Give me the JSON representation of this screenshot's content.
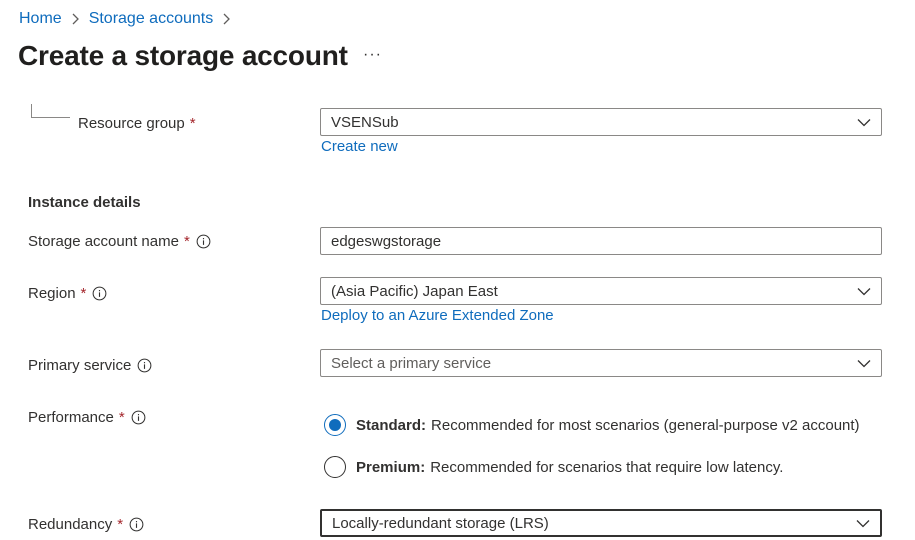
{
  "breadcrumb": {
    "items": [
      "Home",
      "Storage accounts"
    ]
  },
  "page": {
    "title": "Create a storage account",
    "more": "···"
  },
  "resource_group": {
    "label": "Resource group",
    "required": "*",
    "value": "VSENSub",
    "create_new": "Create new"
  },
  "instance_details": {
    "title": "Instance details"
  },
  "storage_account_name": {
    "label": "Storage account name",
    "required": "*",
    "value": "edgeswgstorage"
  },
  "region": {
    "label": "Region",
    "required": "*",
    "value": "(Asia Pacific) Japan East",
    "extended_zone_link": "Deploy to an Azure Extended Zone"
  },
  "primary_service": {
    "label": "Primary service",
    "placeholder": "Select a primary service"
  },
  "performance": {
    "label": "Performance",
    "required": "*",
    "options": [
      {
        "name": "Standard:",
        "desc": "Recommended for most scenarios (general-purpose v2 account)",
        "checked": true
      },
      {
        "name": "Premium:",
        "desc": "Recommended for scenarios that require low latency.",
        "checked": false
      }
    ]
  },
  "redundancy": {
    "label": "Redundancy",
    "required": "*",
    "value": "Locally-redundant storage (LRS)"
  },
  "colors": {
    "accent": "#0f6cbd",
    "required": "#a4262c",
    "text": "#323130",
    "border": "#8a8886"
  }
}
